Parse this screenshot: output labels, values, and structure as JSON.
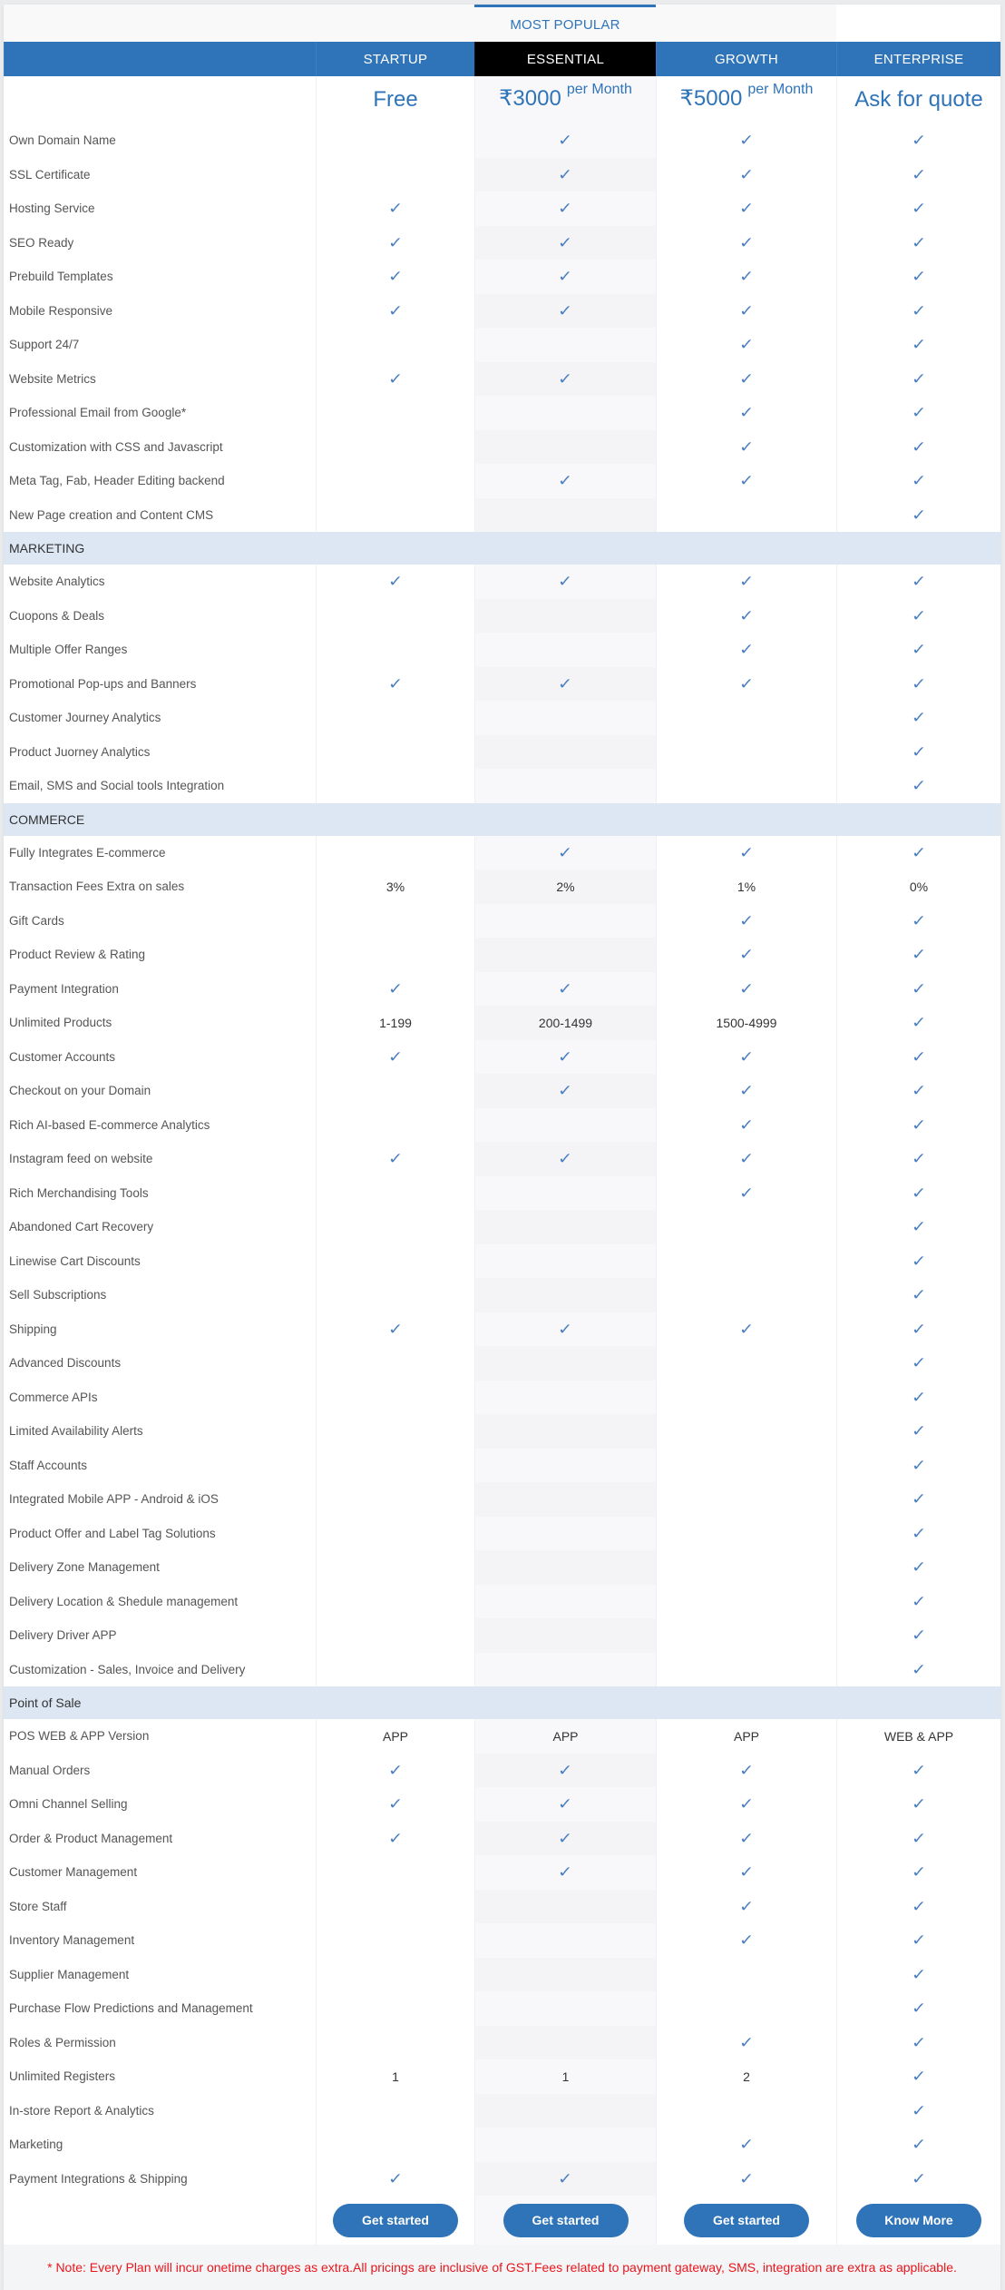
{
  "most_popular_label": "MOST POPULAR",
  "plans": [
    {
      "name": "STARTUP",
      "price": "Free",
      "price_suffix": "",
      "button": "Get started"
    },
    {
      "name": "ESSENTIAL",
      "price": "₹3000",
      "price_suffix": "per Month",
      "button": "Get started"
    },
    {
      "name": "GROWTH",
      "price": "₹5000",
      "price_suffix": "per Month",
      "button": "Get started"
    },
    {
      "name": "ENTERPRISE",
      "price": "Ask for quote",
      "price_suffix": "",
      "button": "Know More"
    }
  ],
  "colors": {
    "accent": "#2f74b9",
    "highlight_header": "#000000",
    "section_band": "#dce7f3",
    "note": "#e8161b",
    "check": "#4a7fc1"
  },
  "check_icon": "checkmark-icon",
  "groups": [
    {
      "section": "",
      "rows": [
        {
          "label": "Own Domain Name",
          "values": [
            "",
            "check",
            "check",
            "check"
          ]
        },
        {
          "label": "SSL Certificate",
          "values": [
            "",
            "check",
            "check",
            "check"
          ]
        },
        {
          "label": "Hosting Service",
          "values": [
            "check",
            "check",
            "check",
            "check"
          ]
        },
        {
          "label": "SEO Ready",
          "values": [
            "check",
            "check",
            "check",
            "check"
          ]
        },
        {
          "label": "Prebuild Templates",
          "values": [
            "check",
            "check",
            "check",
            "check"
          ]
        },
        {
          "label": "Mobile Responsive",
          "values": [
            "check",
            "check",
            "check",
            "check"
          ]
        },
        {
          "label": "Support 24/7",
          "values": [
            "",
            "",
            "check",
            "check"
          ]
        },
        {
          "label": "Website Metrics",
          "values": [
            "check",
            "check",
            "check",
            "check"
          ]
        },
        {
          "label": "Professional Email from Google*",
          "values": [
            "",
            "",
            "check",
            "check"
          ]
        },
        {
          "label": "Customization with CSS and Javascript",
          "values": [
            "",
            "",
            "check",
            "check"
          ]
        },
        {
          "label": "Meta Tag, Fab, Header Editing backend",
          "values": [
            "",
            "check",
            "check",
            "check"
          ]
        },
        {
          "label": "New Page creation and Content CMS",
          "values": [
            "",
            "",
            "",
            "check"
          ]
        }
      ]
    },
    {
      "section": "MARKETING",
      "rows": [
        {
          "label": "Website Analytics",
          "values": [
            "check",
            "check",
            "check",
            "check"
          ]
        },
        {
          "label": "Cuopons & Deals",
          "values": [
            "",
            "",
            "check",
            "check"
          ]
        },
        {
          "label": "Multiple Offer Ranges",
          "values": [
            "",
            "",
            "check",
            "check"
          ]
        },
        {
          "label": "Promotional Pop-ups and Banners",
          "values": [
            "check",
            "check",
            "check",
            "check"
          ]
        },
        {
          "label": "Customer Journey Analytics",
          "values": [
            "",
            "",
            "",
            "check"
          ]
        },
        {
          "label": "Product Juorney Analytics",
          "values": [
            "",
            "",
            "",
            "check"
          ]
        },
        {
          "label": "Email, SMS and Social tools Integration",
          "values": [
            "",
            "",
            "",
            "check"
          ]
        }
      ]
    },
    {
      "section": "COMMERCE",
      "rows": [
        {
          "label": "Fully Integrates E-commerce",
          "values": [
            "",
            "check",
            "check",
            "check"
          ]
        },
        {
          "label": "Transaction Fees Extra on sales",
          "values": [
            "3%",
            "2%",
            "1%",
            "0%"
          ]
        },
        {
          "label": "Gift Cards",
          "values": [
            "",
            "",
            "check",
            "check"
          ]
        },
        {
          "label": "Product Review & Rating",
          "values": [
            "",
            "",
            "check",
            "check"
          ]
        },
        {
          "label": "Payment Integration",
          "values": [
            "check",
            "check",
            "check",
            "check"
          ]
        },
        {
          "label": "Unlimited Products",
          "values": [
            "1-199",
            "200-1499",
            "1500-4999",
            "check"
          ]
        },
        {
          "label": "Customer Accounts",
          "values": [
            "check",
            "check",
            "check",
            "check"
          ]
        },
        {
          "label": "Checkout on your Domain",
          "values": [
            "",
            "check",
            "check",
            "check"
          ]
        },
        {
          "label": "Rich AI-based E-commerce Analytics",
          "values": [
            "",
            "",
            "check",
            "check"
          ]
        },
        {
          "label": "Instagram feed on website",
          "values": [
            "check",
            "check",
            "check",
            "check"
          ]
        },
        {
          "label": "Rich Merchandising Tools",
          "values": [
            "",
            "",
            "check",
            "check"
          ]
        },
        {
          "label": "Abandoned Cart Recovery",
          "values": [
            "",
            "",
            "",
            "check"
          ]
        },
        {
          "label": "Linewise Cart Discounts",
          "values": [
            "",
            "",
            "",
            "check"
          ]
        },
        {
          "label": "Sell Subscriptions",
          "values": [
            "",
            "",
            "",
            "check"
          ]
        },
        {
          "label": "Shipping",
          "values": [
            "check",
            "check",
            "check",
            "check"
          ]
        },
        {
          "label": "Advanced Discounts",
          "values": [
            "",
            "",
            "",
            "check"
          ]
        },
        {
          "label": "Commerce APIs",
          "values": [
            "",
            "",
            "",
            "check"
          ]
        },
        {
          "label": "Limited Availability Alerts",
          "values": [
            "",
            "",
            "",
            "check"
          ]
        },
        {
          "label": "Staff Accounts",
          "values": [
            "",
            "",
            "",
            "check"
          ]
        },
        {
          "label": "Integrated Mobile APP - Android & iOS",
          "values": [
            "",
            "",
            "",
            "check"
          ]
        },
        {
          "label": "Product Offer and Label Tag Solutions",
          "values": [
            "",
            "",
            "",
            "check"
          ]
        },
        {
          "label": "Delivery Zone Management",
          "values": [
            "",
            "",
            "",
            "check"
          ]
        },
        {
          "label": "Delivery Location & Shedule management",
          "values": [
            "",
            "",
            "",
            "check"
          ]
        },
        {
          "label": "Delivery Driver APP",
          "values": [
            "",
            "",
            "",
            "check"
          ]
        },
        {
          "label": "Customization - Sales, Invoice and Delivery",
          "values": [
            "",
            "",
            "",
            "check"
          ]
        }
      ]
    },
    {
      "section": "Point of Sale",
      "rows": [
        {
          "label": "POS WEB & APP Version",
          "values": [
            "APP",
            "APP",
            "APP",
            "WEB & APP"
          ]
        },
        {
          "label": "Manual Orders",
          "values": [
            "check",
            "check",
            "check",
            "check"
          ]
        },
        {
          "label": "Omni Channel Selling",
          "values": [
            "check",
            "check",
            "check",
            "check"
          ]
        },
        {
          "label": "Order & Product Management",
          "values": [
            "check",
            "check",
            "check",
            "check"
          ]
        },
        {
          "label": "Customer Management",
          "values": [
            "",
            "check",
            "check",
            "check"
          ]
        },
        {
          "label": "Store Staff",
          "values": [
            "",
            "",
            "check",
            "check"
          ]
        },
        {
          "label": "Inventory Management",
          "values": [
            "",
            "",
            "check",
            "check"
          ]
        },
        {
          "label": "Supplier Management",
          "values": [
            "",
            "",
            "",
            "check"
          ]
        },
        {
          "label": "Purchase Flow Predictions and Management",
          "values": [
            "",
            "",
            "",
            "check"
          ]
        },
        {
          "label": "Roles & Permission",
          "values": [
            "",
            "",
            "check",
            "check"
          ]
        },
        {
          "label": "Unlimited Registers",
          "values": [
            "1",
            "1",
            "2",
            "check"
          ]
        },
        {
          "label": "In-store Report & Analytics",
          "values": [
            "",
            "",
            "",
            "check"
          ]
        },
        {
          "label": "Marketing",
          "values": [
            "",
            "",
            "check",
            "check"
          ]
        },
        {
          "label": "Payment Integrations & Shipping",
          "values": [
            "check",
            "check",
            "check",
            "check"
          ]
        }
      ]
    }
  ],
  "note": "* Note: Every Plan will incur onetime charges as extra.All pricings are inclusive of GST.Fees related to payment gateway, SMS, integration are extra as applicable."
}
